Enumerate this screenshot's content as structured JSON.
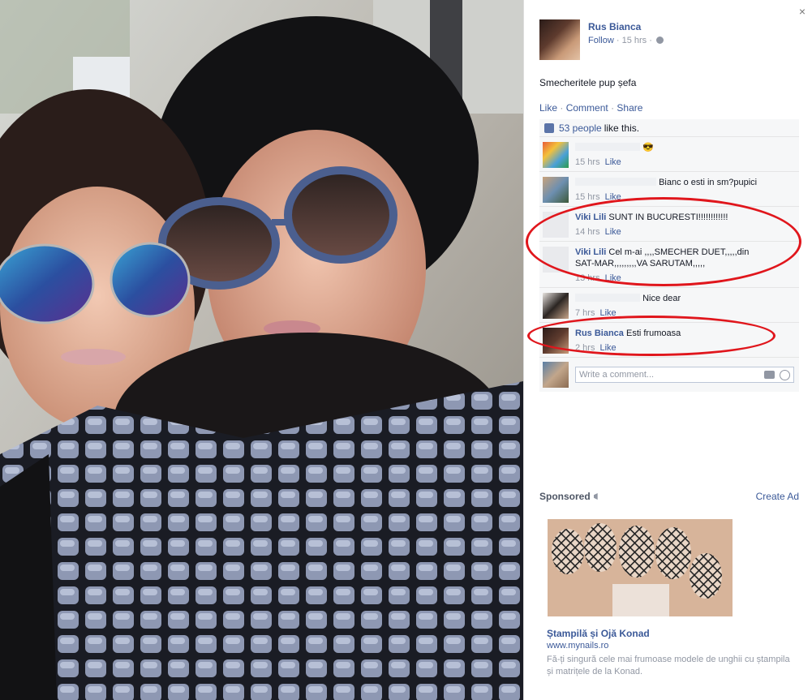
{
  "post": {
    "author": "Rus Bianca",
    "follow": "Follow",
    "time": "15 hrs",
    "caption": "Smecheritele pup șefa",
    "actions": {
      "like": "Like",
      "comment": "Comment",
      "share": "Share",
      "sep": "·"
    },
    "close": "×"
  },
  "likes": {
    "count": "53 people",
    "text": "like this."
  },
  "comments": [
    {
      "name": "",
      "text": "😎",
      "time": "15 hrs",
      "like": "Like"
    },
    {
      "name": "",
      "text": "Bianc o esti in sm?pupici",
      "time": "15 hrs",
      "like": "Like"
    },
    {
      "name": "Viki Lili",
      "text": "SUNT IN BUCURESTI!!!!!!!!!!!!",
      "time": "14 hrs",
      "like": "Like"
    },
    {
      "name": "Viki Lili",
      "text": "Cel m-ai ,,,,SMECHER DUET,,,,,din SAT-MAR,,,,,,,,,VA SARUTAM,,,,,",
      "time": "13 hrs",
      "like": "Like"
    },
    {
      "name": "",
      "text": "Nice dear",
      "time": "7 hrs",
      "like": "Like"
    },
    {
      "name": "Rus Bianca",
      "text": "Esti frumoasa",
      "time": "2 hrs",
      "like": "Like"
    }
  ],
  "compose": {
    "placeholder": "Write a comment..."
  },
  "sponsored": {
    "label": "Sponsored",
    "create_ad": "Create Ad",
    "ad_title": "Ștampilă și Ojă Konad",
    "ad_url": "www.mynails.ro",
    "ad_desc": "Fă-ți singură cele mai frumoase modele de unghii cu ștampila și matrițele de la Konad."
  },
  "colors": {
    "link": "#3b5998",
    "annotation": "#e0161c",
    "muted": "#9197a3"
  }
}
